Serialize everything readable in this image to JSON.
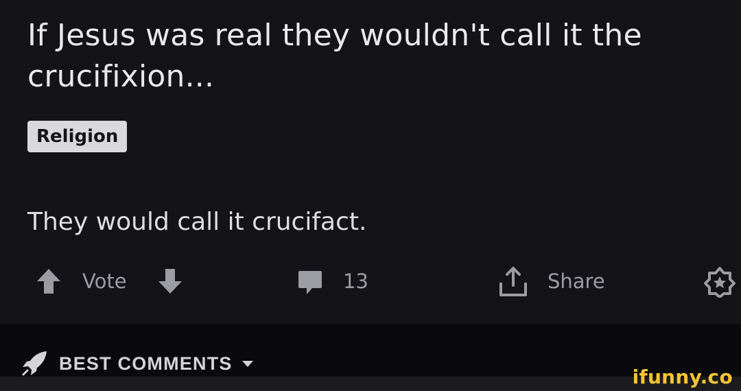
{
  "post": {
    "title": "If Jesus was real they wouldn't call it the crucifixion...",
    "flair": "Religion",
    "body": "They would call it crucifact."
  },
  "actions": {
    "vote_label": "Vote",
    "comments_count": "13",
    "share_label": "Share",
    "icons": {
      "upvote": "arrow-up-icon",
      "downvote": "arrow-down-icon",
      "comments": "comment-bubble-icon",
      "share": "share-icon",
      "award": "award-icon"
    }
  },
  "comments_header": {
    "label": "BEST COMMENTS",
    "icons": {
      "sort": "rocket-icon",
      "dropdown": "chevron-down-icon"
    }
  },
  "watermark": {
    "text": "ifunny.co"
  },
  "colors": {
    "background": "#141418",
    "title_text": "#e9e9ee",
    "flair_background": "#d9d9dd",
    "secondary_text": "#9c9ca4",
    "watermark": "#f7c531"
  }
}
